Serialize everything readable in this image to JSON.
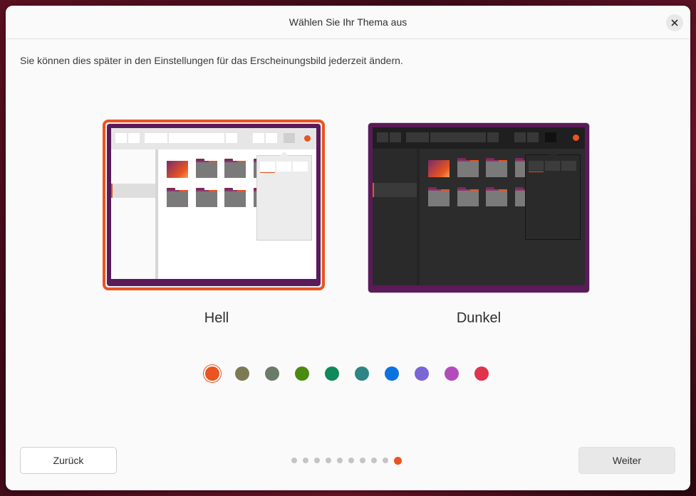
{
  "window": {
    "title": "Wählen Sie Ihr Thema aus",
    "subtitle": "Sie können dies später in den Einstellungen für das Erscheinungsbild jederzeit ändern."
  },
  "themes": [
    {
      "label": "Hell",
      "selected": true
    },
    {
      "label": "Dunkel",
      "selected": false
    }
  ],
  "accent_colors": [
    {
      "color": "#e95420",
      "selected": true
    },
    {
      "color": "#7c7a55"
    },
    {
      "color": "#6b7b6a"
    },
    {
      "color": "#4a8a10"
    },
    {
      "color": "#0e8a5a"
    },
    {
      "color": "#2e8585"
    },
    {
      "color": "#0a73e0"
    },
    {
      "color": "#7a66d6"
    },
    {
      "color": "#b34cbb"
    },
    {
      "color": "#e0334e"
    }
  ],
  "footer": {
    "back_label": "Zurück",
    "next_label": "Weiter",
    "page_count": 10,
    "current_page": 10
  },
  "colors": {
    "accent": "#e95420"
  },
  "icons": {
    "close": "close-icon"
  }
}
